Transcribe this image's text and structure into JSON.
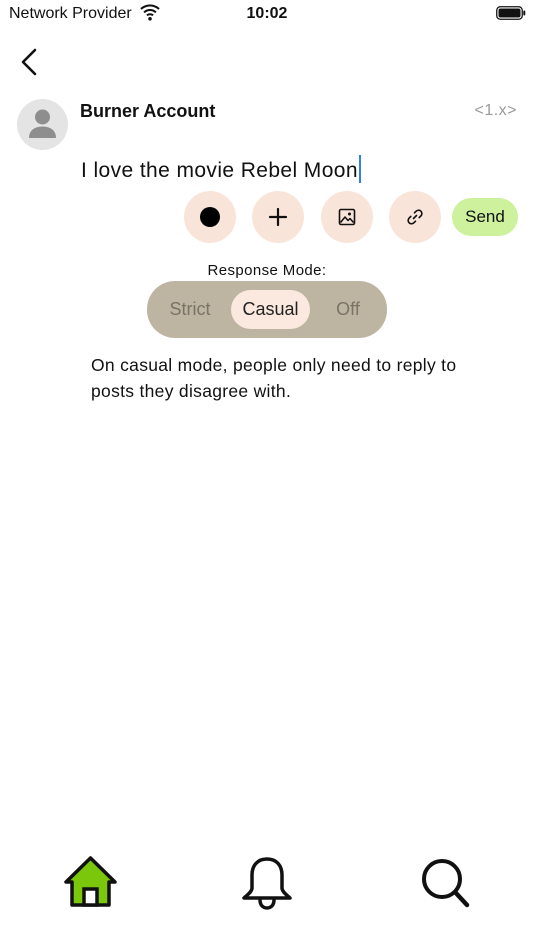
{
  "status_bar": {
    "carrier": "Network Provider",
    "time": "10:02",
    "icons": [
      "wifi-icon",
      "battery-icon"
    ]
  },
  "navigation": {
    "back_icon": "chevron-left-icon"
  },
  "post": {
    "account_name": "Burner Account",
    "version_tag": "<1.x>",
    "text": "I love the movie Rebel Moon",
    "avatar_icon": "person-icon"
  },
  "toolbar": {
    "buttons": [
      {
        "name": "record",
        "icon": "record-dot-icon"
      },
      {
        "name": "add",
        "icon": "plus-icon"
      },
      {
        "name": "image",
        "icon": "image-icon"
      },
      {
        "name": "link",
        "icon": "link-icon"
      }
    ],
    "send_label": "Send"
  },
  "response_mode": {
    "label": "Response Mode:",
    "options": [
      "Strict",
      "Casual",
      "Off"
    ],
    "selected": "Casual",
    "description": "On casual mode, people only need to reply to posts they disagree with."
  },
  "tab_bar": {
    "items": [
      {
        "name": "home",
        "icon": "home-icon",
        "active": true
      },
      {
        "name": "notifications",
        "icon": "bell-icon",
        "active": false
      },
      {
        "name": "search",
        "icon": "search-icon",
        "active": false
      }
    ]
  },
  "colors": {
    "tool_button_bg": "#f9e4da",
    "send_bg": "#cdf19c",
    "segment_bg": "#bdb5a2",
    "segment_selected_bg": "#fbe9df",
    "home_active": "#7ac70c",
    "caret": "#2f80ed"
  }
}
